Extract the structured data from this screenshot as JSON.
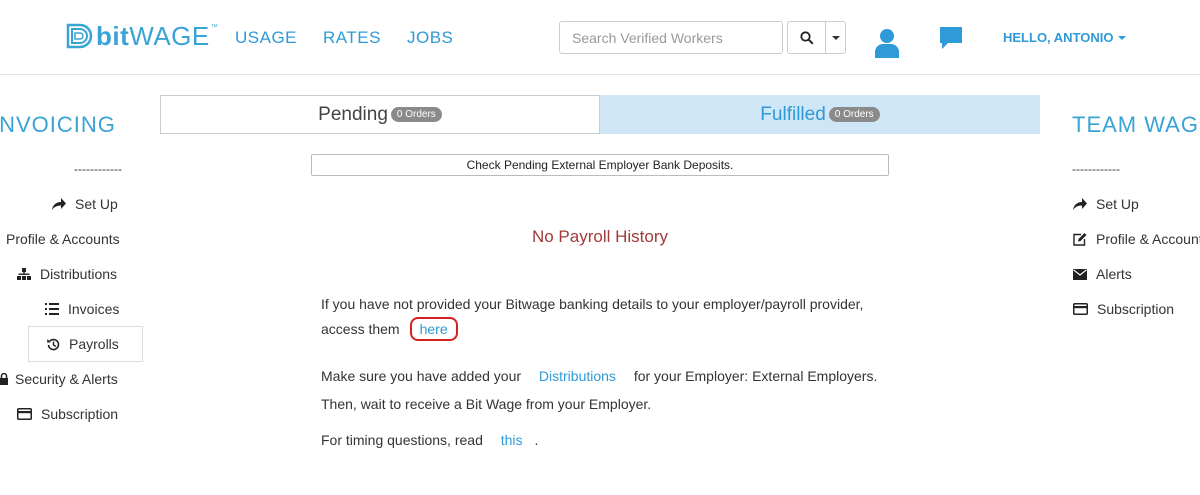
{
  "header": {
    "logo_bit": "bit",
    "logo_wage": "WAGE",
    "logo_tm": "™",
    "nav": [
      "USAGE",
      "RATES",
      "JOBS"
    ],
    "search_placeholder": "Search Verified Workers",
    "greeting": "HELLO, ANTONIO"
  },
  "left": {
    "title": "INVOICING",
    "dashes": "------------",
    "items": [
      "Set Up",
      "Profile & Accounts",
      "Distributions",
      "Invoices",
      "Payrolls",
      "Security & Alerts",
      "Subscription"
    ]
  },
  "right": {
    "title": "TEAM WAGE",
    "dashes": "------------",
    "items": [
      "Set Up",
      "Profile & Accounts",
      "Alerts",
      "Subscription"
    ]
  },
  "tabs": {
    "pending": "Pending",
    "pending_badge": "0 Orders",
    "fulfilled": "Fulfilled",
    "fulfilled_badge": "0 Orders"
  },
  "main": {
    "check_button": "Check Pending External Employer Bank Deposits.",
    "no_history": "No Payroll History",
    "p1_line1": "If you have not provided your Bitwage banking details to your employer/payroll provider,",
    "p1_line2": "access them",
    "p1_link": "here",
    "p2_pre": "Make sure you have added your",
    "p2_link": "Distributions",
    "p2_post": "for your Employer: External Employers.",
    "p3": "Then, wait to receive a Bit Wage from your Employer.",
    "p4_pre": "For timing questions, read",
    "p4_link": "this",
    "p4_post": "."
  },
  "colors": {
    "accent": "#2f9ad8",
    "alert_text": "#a33a3a",
    "fulfilled_bg": "#cfe6f7",
    "highlight_ring": "#d32020"
  }
}
